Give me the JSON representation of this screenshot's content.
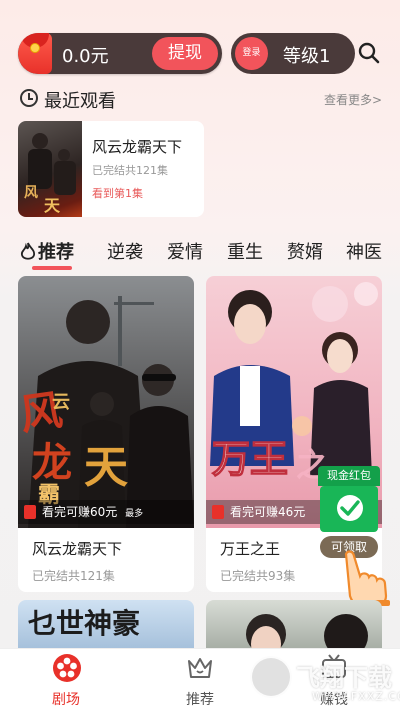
{
  "header": {
    "balance": "0.0元",
    "withdraw_label": "提现",
    "login_label": "登录",
    "level_label": "等级1"
  },
  "recent": {
    "title": "最近观看",
    "more_label": "查看更多>",
    "item": {
      "name": "风云龙霸天下",
      "status": "已完结共121集",
      "progress": "看到第1集"
    }
  },
  "tabs": [
    {
      "label": "推荐",
      "active": true
    },
    {
      "label": "逆袭"
    },
    {
      "label": "爱情"
    },
    {
      "label": "重生"
    },
    {
      "label": "赘婿"
    },
    {
      "label": "神医"
    }
  ],
  "cards": [
    {
      "title": "风云龙霸天下",
      "sub": "已完结共121集",
      "reward": "看完可赚60元",
      "reward_suffix": "最多",
      "poster_text": "风云龙霸天"
    },
    {
      "title": "万王之王",
      "sub": "已完结共93集",
      "reward": "看完可赚46元",
      "poster_text": "万王之"
    }
  ],
  "second_row": {
    "left_poster_text": "乜世神豪"
  },
  "float_redpack": {
    "label": "现金红包",
    "claim": "可领取"
  },
  "bottom_nav": [
    {
      "label": "剧场",
      "icon": "film-reel-icon",
      "active": true
    },
    {
      "label": "推荐",
      "icon": "crown-icon"
    },
    {
      "label": "赚钱",
      "icon": "tv-icon"
    }
  ],
  "watermark": {
    "brand": "飞翔下载",
    "url": "WWW.FXXZ.COM"
  },
  "colors": {
    "accent": "#f2545b",
    "dark_pill": "#4a3a3a",
    "green": "#19b657"
  }
}
